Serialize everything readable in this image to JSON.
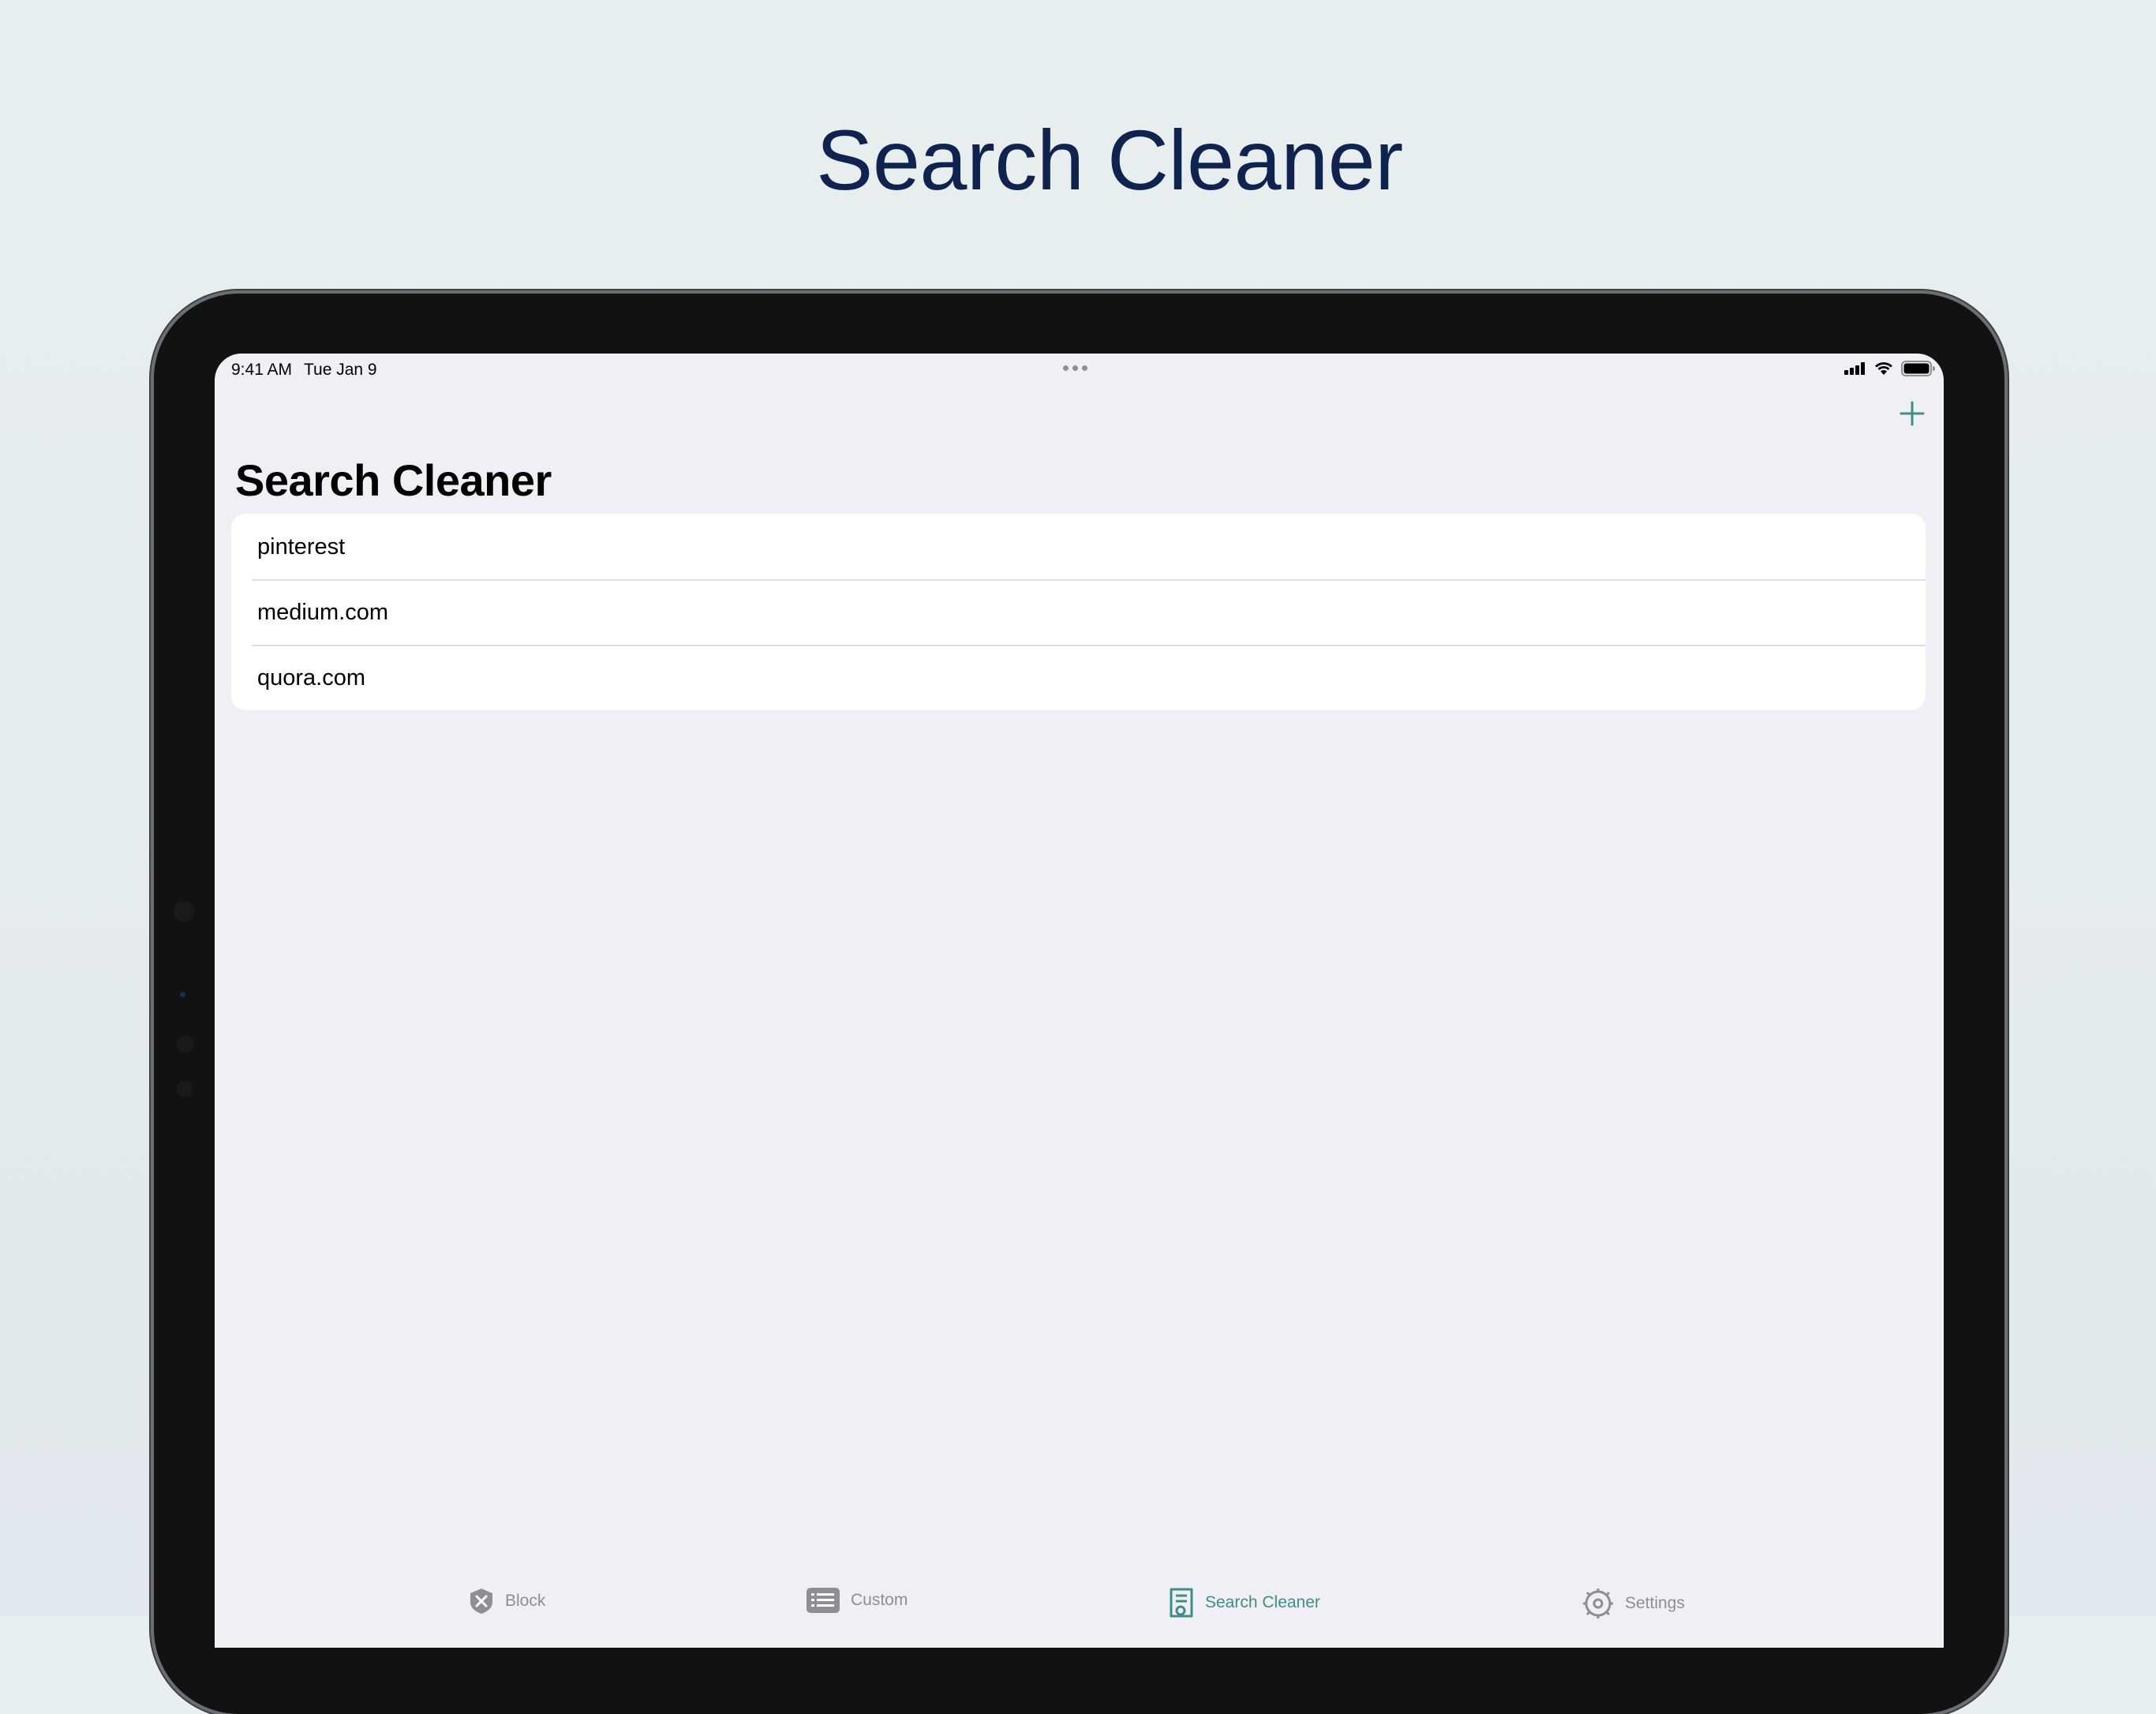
{
  "hero": {
    "title": "Search Cleaner"
  },
  "status_bar": {
    "time": "9:41 AM",
    "date": "Tue Jan 9",
    "icons": [
      "cellular-signal-icon",
      "wifi-icon",
      "battery-icon"
    ]
  },
  "navigation": {
    "title": "Search Cleaner",
    "add_icon": "plus-icon"
  },
  "list": {
    "items": [
      {
        "label": "pinterest"
      },
      {
        "label": "medium.com"
      },
      {
        "label": "quora.com"
      }
    ]
  },
  "tab_bar": {
    "active": "Search Cleaner",
    "tabs": [
      {
        "label": "Block",
        "icon": "shield-x-icon"
      },
      {
        "label": "Custom",
        "icon": "list-icon"
      },
      {
        "label": "Search Cleaner",
        "icon": "document-search-icon"
      },
      {
        "label": "Settings",
        "icon": "gear-icon"
      }
    ]
  },
  "colors": {
    "accent": "#3c8f86",
    "hero_text": "#0f2350",
    "background": "#efeff4",
    "inactive": "#8e8e93"
  }
}
